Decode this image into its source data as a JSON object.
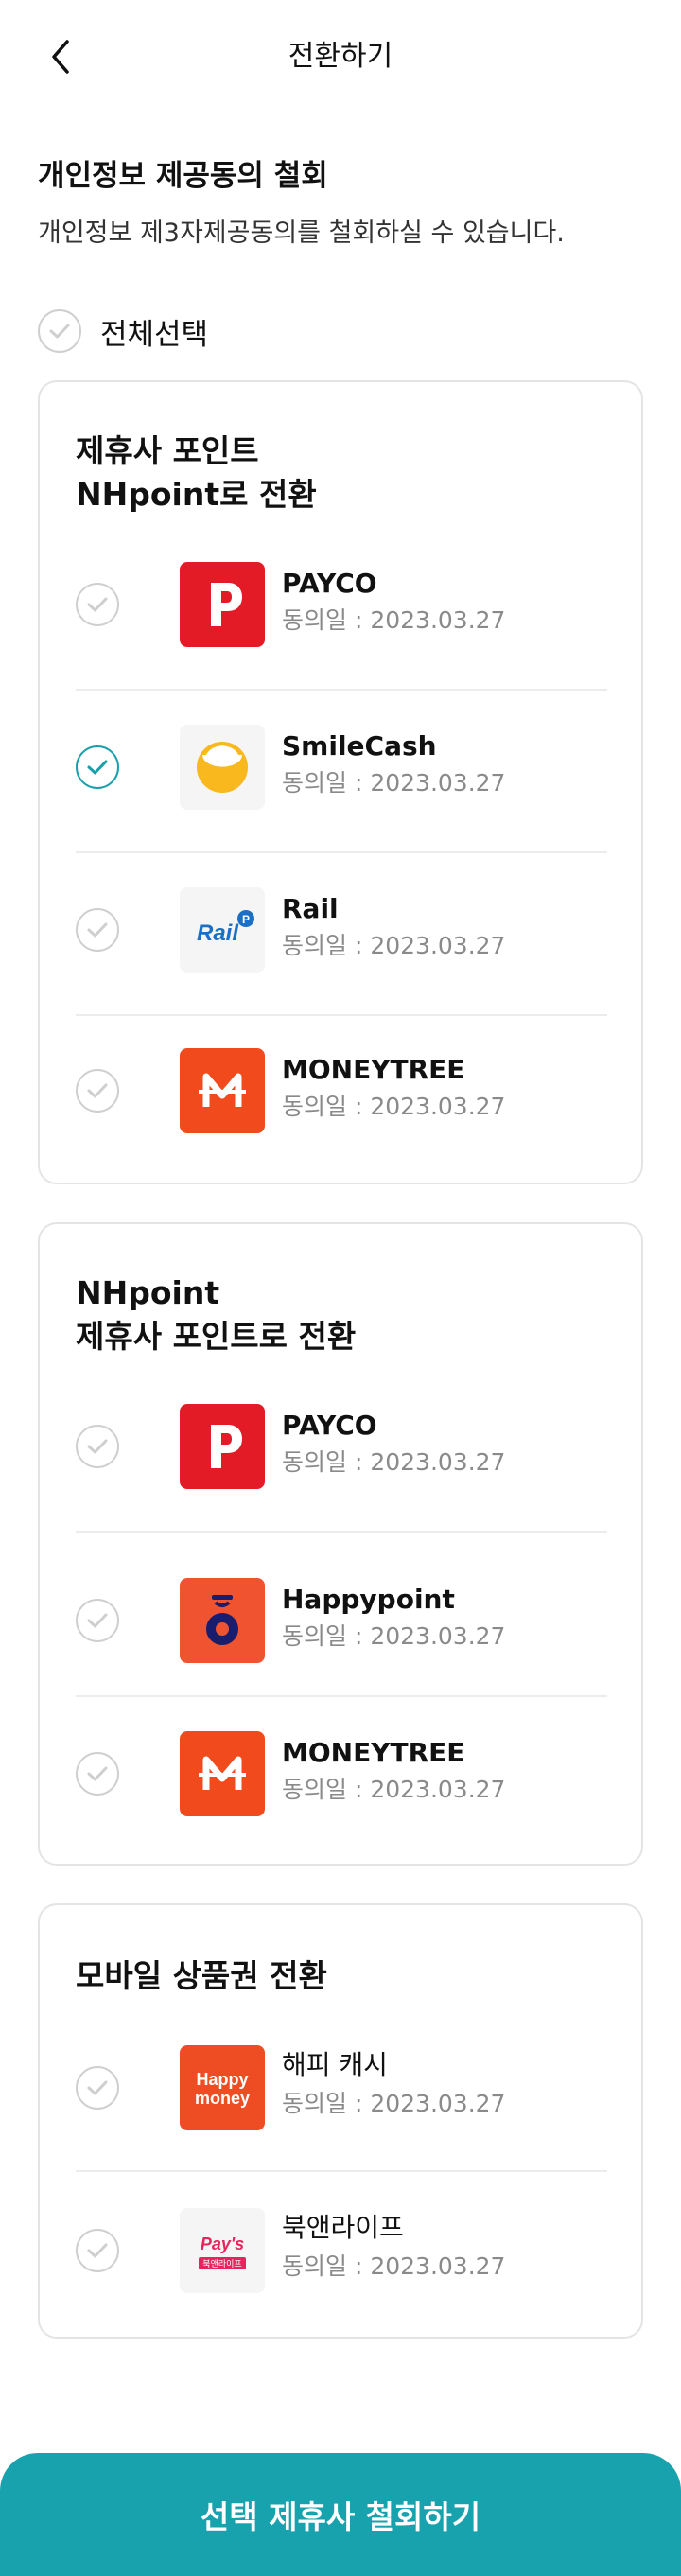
{
  "header": {
    "title": "전환하기"
  },
  "intro": {
    "title": "개인정보 제공동의 철회",
    "description": "개인정보 제3자제공동의를 철회하실 수 있습니다."
  },
  "select_all": {
    "label": "전체선택",
    "checked": false
  },
  "colors": {
    "accent": "#18a2ad",
    "check_off": "#cfcfcf",
    "date_text": "#8a8a8a"
  },
  "sections": [
    {
      "title": "제휴사 포인트\nNHpoint로 전환",
      "items": [
        {
          "name": "PAYCO",
          "date": "동의일 : 2023.03.27",
          "checked": false,
          "logo": "payco-logo"
        },
        {
          "name": "SmileCash",
          "date": "동의일 : 2023.03.27",
          "checked": true,
          "logo": "smilecash-logo"
        },
        {
          "name": "Rail",
          "date": "동의일 : 2023.03.27",
          "checked": false,
          "logo": "railp-logo",
          "logo_text": "Rail"
        },
        {
          "name": "MONEYTREE",
          "date": "동의일 : 2023.03.27",
          "checked": false,
          "logo": "moneytree-logo"
        }
      ]
    },
    {
      "title": "NHpoint\n제휴사 포인트로 전환",
      "items": [
        {
          "name": "PAYCO",
          "date": "동의일 : 2023.03.27",
          "checked": false,
          "logo": "payco-logo"
        },
        {
          "name": "Happypoint",
          "date": "동의일 : 2023.03.27",
          "checked": false,
          "logo": "happypoint-logo"
        },
        {
          "name": "MONEYTREE",
          "date": "동의일 : 2023.03.27",
          "checked": false,
          "logo": "moneytree-logo"
        }
      ]
    },
    {
      "title": "모바일 상품권 전환",
      "items": [
        {
          "name": "해피 캐시",
          "date": "동의일 : 2023.03.27",
          "checked": false,
          "logo": "happymoney-logo",
          "logo_text": [
            "Happy",
            "money"
          ]
        },
        {
          "name": "북앤라이프",
          "date": "동의일 : 2023.03.27",
          "checked": false,
          "logo": "paysbooknlife-logo",
          "logo_text": [
            "Pay's",
            "북앤라이프"
          ]
        }
      ]
    }
  ],
  "cta": {
    "label": "선택 제휴사 철회하기"
  }
}
